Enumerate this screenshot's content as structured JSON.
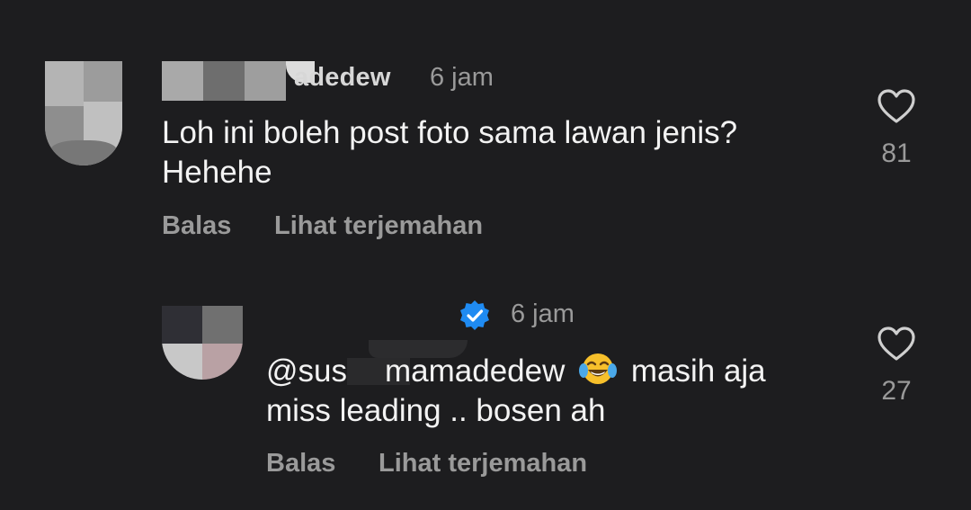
{
  "comments": [
    {
      "username_visible": "adedew",
      "time": "6 jam",
      "text_line1": "Loh ini boleh post foto sama lawan jenis?",
      "text_line2": "Hehehe",
      "reply_label": "Balas",
      "translate_label": "Lihat terjemahan",
      "like_count": "81"
    },
    {
      "time": "6 jam",
      "mention": "@sus",
      "mention_rest": "mamadedew",
      "emoji": "face-with-tears-of-joy",
      "text_after_emoji": "masih aja",
      "text_line2": "miss leading .. bosen ah",
      "reply_label": "Balas",
      "translate_label": "Lihat terjemahan",
      "like_count": "27",
      "verified": true
    }
  ],
  "colors": {
    "background": "#1d1d1f",
    "text_primary": "#f3f3f3",
    "text_secondary": "#9a9a9a",
    "verified_blue": "#1f8bf2"
  }
}
